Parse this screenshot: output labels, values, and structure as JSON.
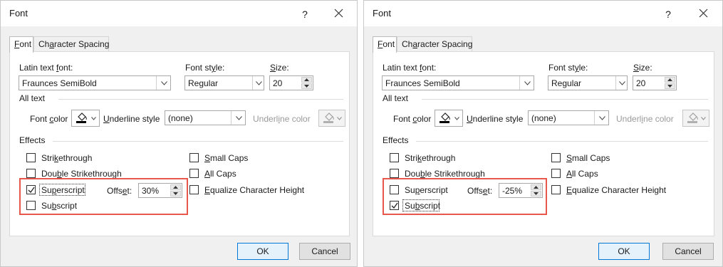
{
  "dialogs": [
    {
      "title": "Font",
      "help_glyph": "?",
      "tabs": {
        "font_pre": "",
        "font_ul": "F",
        "font_post": "ont",
        "char_pre": "Ch",
        "char_ul": "a",
        "char_post": "racter Spacing"
      },
      "latin_label_pre": "Latin text ",
      "latin_label_ul": "f",
      "latin_label_post": "ont:",
      "latin_value": "Fraunces SemiBold",
      "style_label_pre": "Font st",
      "style_label_ul": "y",
      "style_label_post": "le:",
      "style_value": "Regular",
      "size_label_pre": "",
      "size_label_ul": "S",
      "size_label_post": "ize:",
      "size_value": "20",
      "all_text": "All text",
      "font_color_pre": "Font ",
      "font_color_ul": "c",
      "font_color_post": "olor",
      "underline_style_pre": "",
      "underline_style_ul": "U",
      "underline_style_post": "nderline style",
      "underline_style_value": "(none)",
      "underline_color_pre": "Underl",
      "underline_color_ul": "i",
      "underline_color_post": "ne color",
      "effects": "Effects",
      "strike_pre": "Stri",
      "strike_ul": "k",
      "strike_post": "ethrough",
      "dstrike_pre": "Dou",
      "dstrike_ul": "b",
      "dstrike_post": "le Strikethrough",
      "superscript_pre": "Su",
      "superscript_ul": "p",
      "superscript_post": "erscript",
      "subscript_pre": "Su",
      "subscript_ul": "b",
      "subscript_post": "script",
      "offset_pre": "Offs",
      "offset_ul": "e",
      "offset_post": "t:",
      "offset_value": "30%",
      "small_caps_pre": "",
      "small_caps_ul": "S",
      "small_caps_post": "mall Caps",
      "all_caps_pre": "",
      "all_caps_ul": "A",
      "all_caps_post": "ll Caps",
      "equalize_pre": "",
      "equalize_ul": "E",
      "equalize_post": "qualize Character Height",
      "superscript_checked": true,
      "subscript_checked": false,
      "ok": "OK",
      "cancel": "Cancel"
    },
    {
      "title": "Font",
      "help_glyph": "?",
      "tabs": {
        "font_pre": "",
        "font_ul": "F",
        "font_post": "ont",
        "char_pre": "Ch",
        "char_ul": "a",
        "char_post": "racter Spacing"
      },
      "latin_label_pre": "Latin text ",
      "latin_label_ul": "f",
      "latin_label_post": "ont:",
      "latin_value": "Fraunces SemiBold",
      "style_label_pre": "Font st",
      "style_label_ul": "y",
      "style_label_post": "le:",
      "style_value": "Regular",
      "size_label_pre": "",
      "size_label_ul": "S",
      "size_label_post": "ize:",
      "size_value": "20",
      "all_text": "All text",
      "font_color_pre": "Font ",
      "font_color_ul": "c",
      "font_color_post": "olor",
      "underline_style_pre": "",
      "underline_style_ul": "U",
      "underline_style_post": "nderline style",
      "underline_style_value": "(none)",
      "underline_color_pre": "Underl",
      "underline_color_ul": "i",
      "underline_color_post": "ne color",
      "effects": "Effects",
      "strike_pre": "Stri",
      "strike_ul": "k",
      "strike_post": "ethrough",
      "dstrike_pre": "Dou",
      "dstrike_ul": "b",
      "dstrike_post": "le Strikethrough",
      "superscript_pre": "Su",
      "superscript_ul": "p",
      "superscript_post": "erscript",
      "subscript_pre": "Su",
      "subscript_ul": "b",
      "subscript_post": "script",
      "offset_pre": "Offs",
      "offset_ul": "e",
      "offset_post": "t:",
      "offset_value": "-25%",
      "small_caps_pre": "",
      "small_caps_ul": "S",
      "small_caps_post": "mall Caps",
      "all_caps_pre": "",
      "all_caps_ul": "A",
      "all_caps_post": "ll Caps",
      "equalize_pre": "",
      "equalize_ul": "E",
      "equalize_post": "qualize Character Height",
      "superscript_checked": false,
      "subscript_checked": true,
      "ok": "OK",
      "cancel": "Cancel"
    }
  ],
  "colors": {
    "highlight": "#e8584a",
    "dialog_bg": "#f0f0f0",
    "primary_border": "#0078d7"
  },
  "icons": {
    "close": "close-icon",
    "dropdown": "chevron-down-icon",
    "spin": "spinner-arrows-icon",
    "bucket": "paint-bucket-icon",
    "check": "checkmark-icon"
  }
}
